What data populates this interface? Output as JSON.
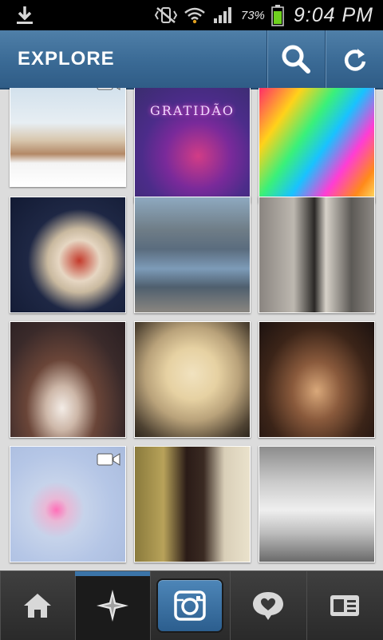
{
  "status_bar": {
    "battery_percent": "73%",
    "time": "9:04 PM",
    "icons": [
      "download-icon",
      "mute-vibrate-icon",
      "wifi-icon",
      "signal-icon",
      "battery-icon"
    ]
  },
  "action_bar": {
    "title": "EXPLORE",
    "buttons": [
      "search-icon",
      "refresh-icon"
    ]
  },
  "grid": {
    "tiles": [
      {
        "name": "photo-boat-sunbathing",
        "has_video": true
      },
      {
        "name": "photo-gratidao",
        "caption": "GRATIDÃO"
      },
      {
        "name": "photo-neon-colors"
      },
      {
        "name": "photo-food-box"
      },
      {
        "name": "photo-blue-car"
      },
      {
        "name": "photo-woman-sign"
      },
      {
        "name": "photo-white-dress-forest"
      },
      {
        "name": "photo-bear-phone-case"
      },
      {
        "name": "photo-group-dinner"
      },
      {
        "name": "photo-girl-pink",
        "has_video": true
      },
      {
        "name": "photo-selfie-mirror"
      },
      {
        "name": "photo-woman-drawing"
      }
    ]
  },
  "tab_bar": {
    "tabs": [
      "home-icon",
      "explore-icon",
      "camera-icon",
      "news-heart-icon",
      "profile-icon"
    ],
    "active": "explore-icon",
    "accent": "#3b74a8"
  }
}
